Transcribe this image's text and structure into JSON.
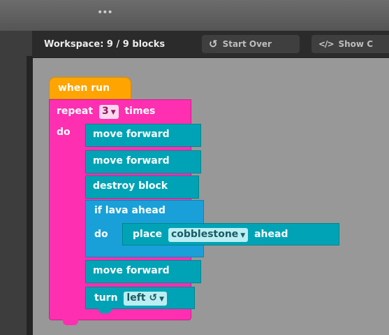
{
  "window": {
    "grip": "•••"
  },
  "header": {
    "workspace_label": "Workspace: 9 / 9 blocks",
    "start_over_label": "Start Over",
    "show_code_label": "Show C",
    "start_over_icon": "undo-icon",
    "show_code_icon": "code-icon"
  },
  "colors": {
    "event_block": "#ffa400",
    "loop_block": "#ff2fb1",
    "action_block": "#00a3b5",
    "condition_block": "#1aa0d8",
    "workspace_bg": "#989898"
  },
  "blocks": {
    "when_run": "when run",
    "repeat": {
      "label": "repeat",
      "count": "3",
      "suffix": "times",
      "do": "do"
    },
    "move_forward_1": "move forward",
    "move_forward_2": "move forward",
    "destroy_block": "destroy block",
    "if_lava": {
      "label": "if lava ahead",
      "do": "do"
    },
    "place": {
      "label": "place",
      "item": "cobblestone",
      "suffix": "ahead"
    },
    "move_forward_3": "move forward",
    "turn": {
      "label": "turn",
      "direction": "left ↺"
    }
  }
}
